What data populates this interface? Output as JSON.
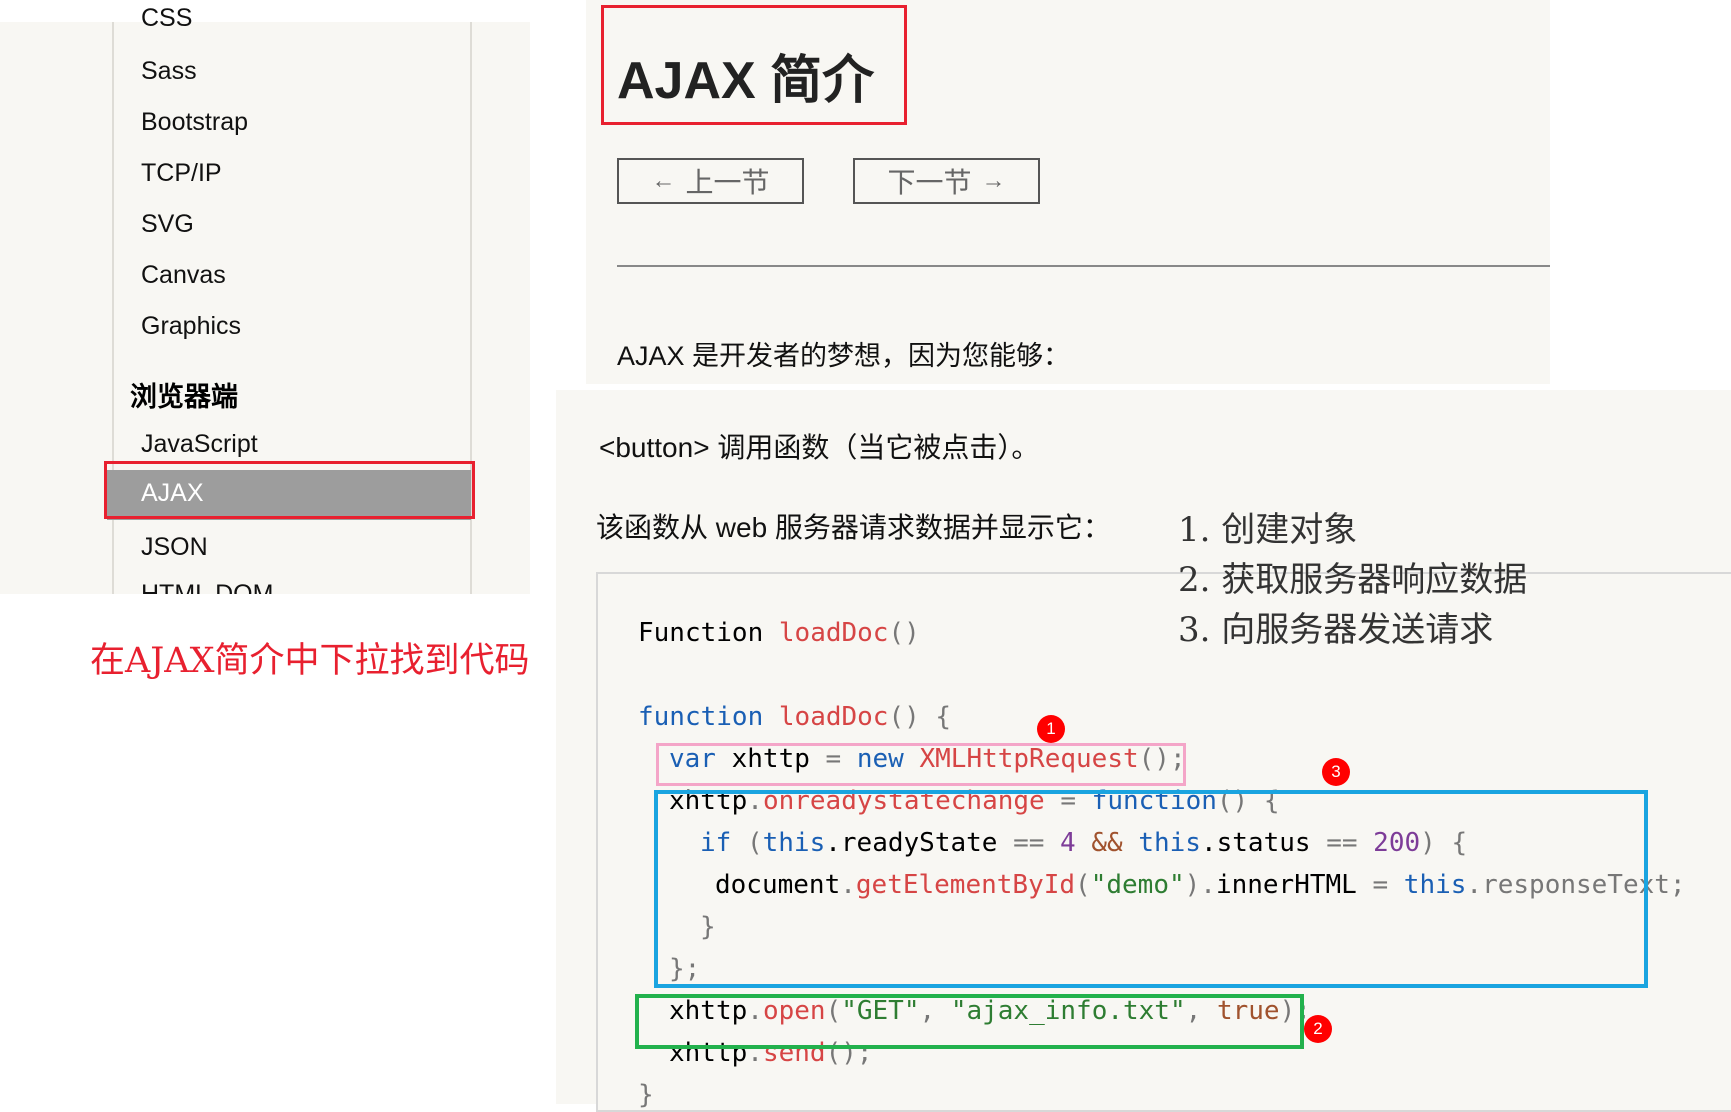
{
  "sidebar": {
    "items": [
      {
        "label": "CSS",
        "partial": true
      },
      {
        "label": "Sass"
      },
      {
        "label": "Bootstrap"
      },
      {
        "label": "TCP/IP"
      },
      {
        "label": "SVG"
      },
      {
        "label": "Canvas"
      },
      {
        "label": "Graphics"
      }
    ],
    "heading": "浏览器端",
    "items2": [
      {
        "label": "JavaScript"
      },
      {
        "label": "AJAX",
        "active": true
      },
      {
        "label": "JSON"
      },
      {
        "label": "HTML DOM",
        "partial": true
      }
    ]
  },
  "page": {
    "title": "AJAX 简介",
    "prev_button": "上一节",
    "next_button": "下一节",
    "intro": "AJAX 是开发者的梦想，因为您能够：",
    "list_item": "<button> 调用函数（当它被点击）。",
    "func_desc": "该函数从 web 服务器请求数据并显示它："
  },
  "annotations": {
    "caption": "在AJAX简介中下拉找到代码",
    "steps": [
      "1. 创建对象",
      "2. 获取服务器响应数据",
      "3. 向服务器发送请求"
    ],
    "badges": [
      "1",
      "2",
      "3"
    ],
    "colors": {
      "red": "#e8202f",
      "pink": "#f4a5c8",
      "blue": "#1aa4e0",
      "green": "#22b14c"
    }
  },
  "code": {
    "header_kw": "Function",
    "header_fn": "loadDoc",
    "header_paren": "()",
    "l1_kw": "function",
    "l1_fn": "loadDoc",
    "l1_rest": "() {",
    "l2_kw": "var",
    "l2_id": " xhttp ",
    "l2_op": "=",
    "l2_new": " new ",
    "l2_fn": "XMLHttpRequest",
    "l2_rest": "();",
    "l3_id": "xhttp",
    "l3_dot": ".",
    "l3_fn": "onreadystatechange",
    "l3_op": " = ",
    "l3_kw": "function",
    "l3_rest": "() {",
    "l4_kw": "if",
    "l4_p": " (",
    "l4_this1": "this",
    "l4_a": ".readyState ",
    "l4_eq1": "==",
    "l4_n1": " 4 ",
    "l4_and": "&&",
    "l4_this2": " this",
    "l4_b": ".status ",
    "l4_eq2": "==",
    "l4_n2": " 200",
    "l4_rest": ") {",
    "l5_id": "document",
    "l5_dot": ".",
    "l5_fn": "getElementById",
    "l5_p1": "(",
    "l5_str": "\"demo\"",
    "l5_p2": ").",
    "l5_prop": "innerHTML ",
    "l5_op": "=",
    "l5_this": " this",
    "l5_rest": ".responseText",
    "l5_semi": ";",
    "l6": "}",
    "l7": "};",
    "l8_id": "xhttp",
    "l8_dot": ".",
    "l8_fn": "open",
    "l8_p1": "(",
    "l8_s1": "\"GET\"",
    "l8_c1": ", ",
    "l8_s2": "\"ajax_info.txt\"",
    "l8_c2": ", ",
    "l8_bool": "true",
    "l8_rest": ");",
    "l9_id": "xhttp",
    "l9_dot": ".",
    "l9_fn": "send",
    "l9_rest": "();",
    "l10": "}"
  }
}
